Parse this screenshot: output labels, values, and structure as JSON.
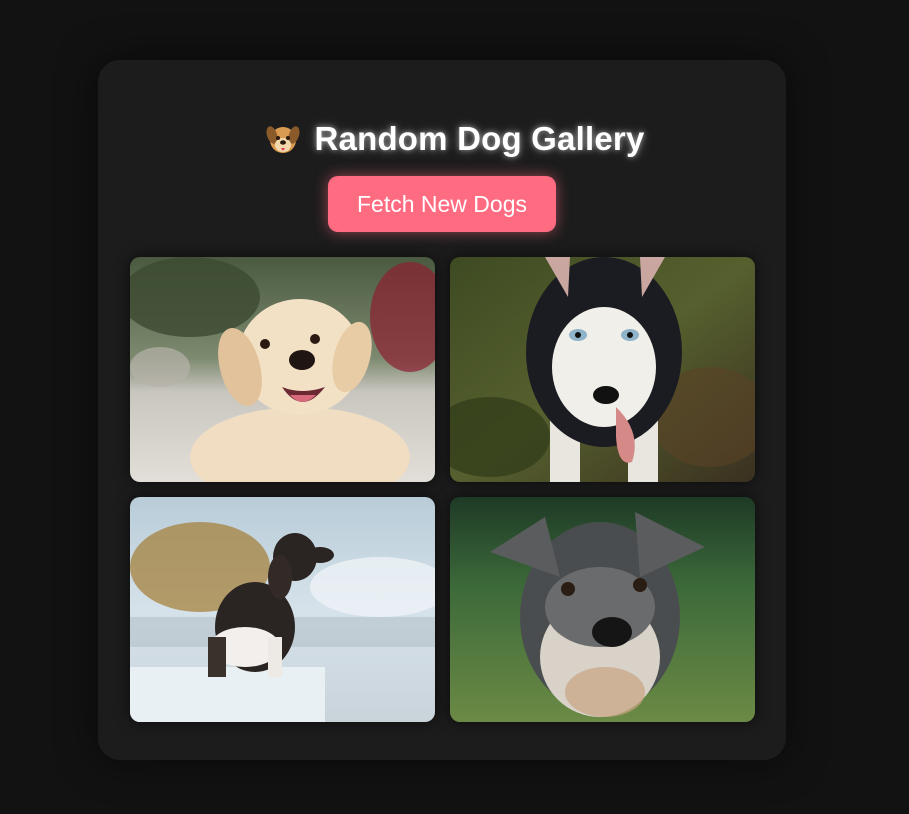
{
  "page": {
    "title": "Random Dog Gallery",
    "title_icon": "dog-face-emoji",
    "fetch_button_label": "Fetch New Dogs"
  },
  "gallery": {
    "images": [
      {
        "subject": "golden retriever",
        "icon": "dog-photo"
      },
      {
        "subject": "siberian husky",
        "icon": "dog-photo"
      },
      {
        "subject": "poodle",
        "icon": "dog-photo"
      },
      {
        "subject": "miniature schnauzer",
        "icon": "dog-photo"
      }
    ]
  },
  "colors": {
    "background": "#121212",
    "card": "#1c1c1c",
    "accent": "#ff6b81",
    "title": "#ffffff"
  }
}
